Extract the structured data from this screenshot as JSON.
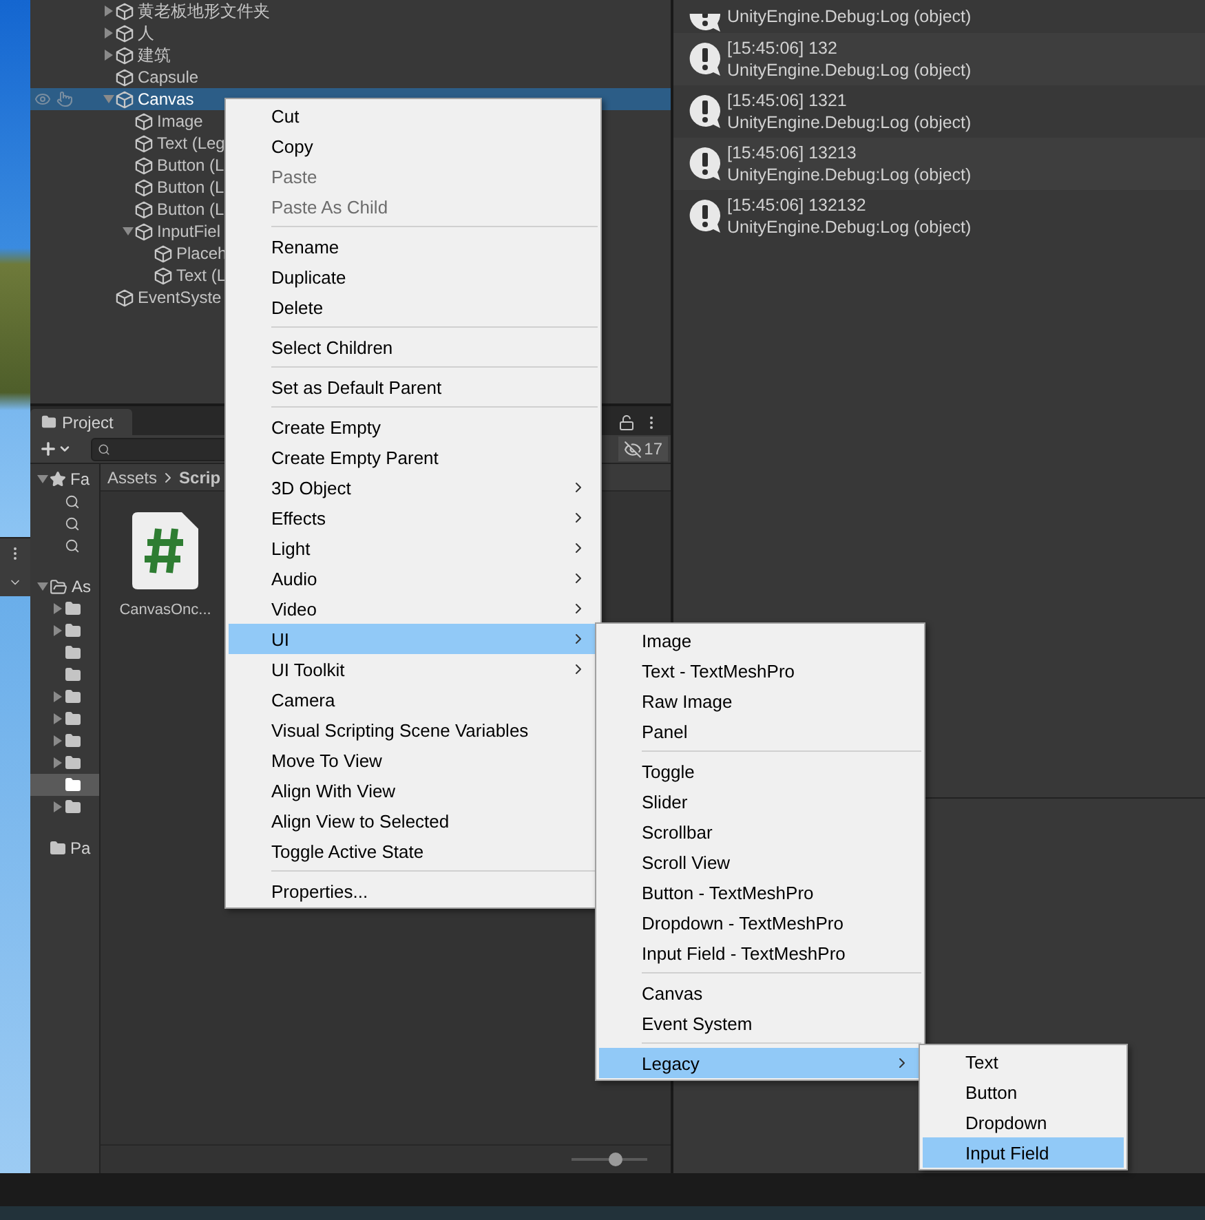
{
  "hierarchy": {
    "items": [
      {
        "label": "黄老板地形文件夹",
        "expanded": false,
        "selected": false,
        "hovered": false
      },
      {
        "label": "人",
        "expanded": false,
        "selected": false,
        "hovered": false
      },
      {
        "label": "建筑",
        "expanded": false,
        "selected": false,
        "hovered": false
      },
      {
        "label": "Capsule",
        "selected": false,
        "hovered": false
      },
      {
        "label": "Canvas",
        "expanded": true,
        "selected": true,
        "hovered": true,
        "children": [
          {
            "label": "Image",
            "selected": false,
            "hovered": false
          },
          {
            "label": "Text (Leg",
            "selected": false,
            "hovered": false
          },
          {
            "label": "Button (L",
            "selected": false,
            "hovered": false
          },
          {
            "label": "Button (L",
            "selected": false,
            "hovered": false
          },
          {
            "label": "Button (L",
            "selected": false,
            "hovered": false
          },
          {
            "label": "InputFiel",
            "expanded": true,
            "selected": false,
            "hovered": false,
            "children": [
              {
                "label": "Placeh",
                "selected": false,
                "hovered": false
              },
              {
                "label": "Text (L",
                "selected": false,
                "hovered": false
              }
            ]
          }
        ]
      },
      {
        "label": "EventSyste",
        "selected": false,
        "hovered": false
      }
    ]
  },
  "project": {
    "tab": "Project",
    "hidden_count": "17",
    "breadcrumb": [
      "Assets",
      "Scrip"
    ],
    "tree": [
      {
        "kind": "favorites",
        "label": "Fa",
        "expanded": true,
        "selected": false,
        "children": [
          {
            "kind": "search",
            "selected": false
          },
          {
            "kind": "search",
            "selected": false
          },
          {
            "kind": "search",
            "selected": false
          }
        ]
      },
      {
        "kind": "folder",
        "label": "As",
        "expanded": true,
        "selected": false,
        "children": [
          {
            "kind": "folder",
            "expanded": false,
            "selected": false
          },
          {
            "kind": "folder",
            "expanded": false,
            "selected": false
          },
          {
            "kind": "folder",
            "selected": false
          },
          {
            "kind": "folder",
            "selected": false
          },
          {
            "kind": "folder",
            "expanded": false,
            "selected": false
          },
          {
            "kind": "folder",
            "expanded": false,
            "selected": false
          },
          {
            "kind": "folder",
            "expanded": false,
            "selected": false
          },
          {
            "kind": "folder",
            "expanded": false,
            "selected": false
          },
          {
            "kind": "folder",
            "selected": true
          },
          {
            "kind": "folder",
            "expanded": false,
            "selected": false
          }
        ]
      },
      {
        "kind": "folder",
        "label": "Pa",
        "selected": false
      }
    ],
    "files": [
      {
        "kind": "script",
        "name": "CanvasOnc..."
      }
    ],
    "zoom": {
      "level": 0.58
    }
  },
  "console": {
    "entries": [
      {
        "message": "UnityEngine.Debug:Log (object)"
      },
      {
        "header": "[15:45:06] 132",
        "message": "UnityEngine.Debug:Log (object)"
      },
      {
        "header": "[15:45:06] 1321",
        "message": "UnityEngine.Debug:Log (object)"
      },
      {
        "header": "[15:45:06] 13213",
        "message": "UnityEngine.Debug:Log (object)"
      },
      {
        "header": "[15:45:06] 132132",
        "message": "UnityEngine.Debug:Log (object)"
      }
    ]
  },
  "context_menu": {
    "items": [
      {
        "kind": "item",
        "label": "Cut",
        "disabled": false,
        "selected": false,
        "submenu": false
      },
      {
        "kind": "item",
        "label": "Copy",
        "disabled": false,
        "selected": false,
        "submenu": false
      },
      {
        "kind": "item",
        "label": "Paste",
        "disabled": true,
        "selected": false,
        "submenu": false
      },
      {
        "kind": "item",
        "label": "Paste As Child",
        "disabled": true,
        "selected": false,
        "submenu": false
      },
      {
        "kind": "separator"
      },
      {
        "kind": "item",
        "label": "Rename",
        "disabled": false,
        "selected": false,
        "submenu": false
      },
      {
        "kind": "item",
        "label": "Duplicate",
        "disabled": false,
        "selected": false,
        "submenu": false
      },
      {
        "kind": "item",
        "label": "Delete",
        "disabled": false,
        "selected": false,
        "submenu": false
      },
      {
        "kind": "separator"
      },
      {
        "kind": "item",
        "label": "Select Children",
        "disabled": false,
        "selected": false,
        "submenu": false
      },
      {
        "kind": "separator"
      },
      {
        "kind": "item",
        "label": "Set as Default Parent",
        "disabled": false,
        "selected": false,
        "submenu": false
      },
      {
        "kind": "separator"
      },
      {
        "kind": "item",
        "label": "Create Empty",
        "disabled": false,
        "selected": false,
        "submenu": false
      },
      {
        "kind": "item",
        "label": "Create Empty Parent",
        "disabled": false,
        "selected": false,
        "submenu": false
      },
      {
        "kind": "item",
        "label": "3D Object",
        "disabled": false,
        "selected": false,
        "submenu": true
      },
      {
        "kind": "item",
        "label": "Effects",
        "disabled": false,
        "selected": false,
        "submenu": true
      },
      {
        "kind": "item",
        "label": "Light",
        "disabled": false,
        "selected": false,
        "submenu": true
      },
      {
        "kind": "item",
        "label": "Audio",
        "disabled": false,
        "selected": false,
        "submenu": true
      },
      {
        "kind": "item",
        "label": "Video",
        "disabled": false,
        "selected": false,
        "submenu": true
      },
      {
        "kind": "item",
        "label": "UI",
        "disabled": false,
        "selected": true,
        "submenu": true
      },
      {
        "kind": "item",
        "label": "UI Toolkit",
        "disabled": false,
        "selected": false,
        "submenu": true
      },
      {
        "kind": "item",
        "label": "Camera",
        "disabled": false,
        "selected": false,
        "submenu": false
      },
      {
        "kind": "item",
        "label": "Visual Scripting Scene Variables",
        "disabled": false,
        "selected": false,
        "submenu": false
      },
      {
        "kind": "item",
        "label": "Move To View",
        "disabled": false,
        "selected": false,
        "submenu": false
      },
      {
        "kind": "item",
        "label": "Align With View",
        "disabled": false,
        "selected": false,
        "submenu": false
      },
      {
        "kind": "item",
        "label": "Align View to Selected",
        "disabled": false,
        "selected": false,
        "submenu": false
      },
      {
        "kind": "item",
        "label": "Toggle Active State",
        "disabled": false,
        "selected": false,
        "submenu": false
      },
      {
        "kind": "separator"
      },
      {
        "kind": "item",
        "label": "Properties...",
        "disabled": false,
        "selected": false,
        "submenu": false
      }
    ]
  },
  "ui_submenu": {
    "items": [
      {
        "kind": "item",
        "label": "Image",
        "disabled": false,
        "selected": false,
        "submenu": false
      },
      {
        "kind": "item",
        "label": "Text - TextMeshPro",
        "disabled": false,
        "selected": false,
        "submenu": false
      },
      {
        "kind": "item",
        "label": "Raw Image",
        "disabled": false,
        "selected": false,
        "submenu": false
      },
      {
        "kind": "item",
        "label": "Panel",
        "disabled": false,
        "selected": false,
        "submenu": false
      },
      {
        "kind": "separator"
      },
      {
        "kind": "item",
        "label": "Toggle",
        "disabled": false,
        "selected": false,
        "submenu": false
      },
      {
        "kind": "item",
        "label": "Slider",
        "disabled": false,
        "selected": false,
        "submenu": false
      },
      {
        "kind": "item",
        "label": "Scrollbar",
        "disabled": false,
        "selected": false,
        "submenu": false
      },
      {
        "kind": "item",
        "label": "Scroll View",
        "disabled": false,
        "selected": false,
        "submenu": false
      },
      {
        "kind": "item",
        "label": "Button - TextMeshPro",
        "disabled": false,
        "selected": false,
        "submenu": false
      },
      {
        "kind": "item",
        "label": "Dropdown - TextMeshPro",
        "disabled": false,
        "selected": false,
        "submenu": false
      },
      {
        "kind": "item",
        "label": "Input Field - TextMeshPro",
        "disabled": false,
        "selected": false,
        "submenu": false
      },
      {
        "kind": "separator"
      },
      {
        "kind": "item",
        "label": "Canvas",
        "disabled": false,
        "selected": false,
        "submenu": false
      },
      {
        "kind": "item",
        "label": "Event System",
        "disabled": false,
        "selected": false,
        "submenu": false
      },
      {
        "kind": "separator"
      },
      {
        "kind": "item",
        "label": "Legacy",
        "disabled": false,
        "selected": true,
        "submenu": true
      }
    ]
  },
  "legacy_submenu": {
    "items": [
      {
        "kind": "item",
        "label": "Text",
        "disabled": false,
        "selected": false,
        "submenu": false
      },
      {
        "kind": "item",
        "label": "Button",
        "disabled": false,
        "selected": false,
        "submenu": false
      },
      {
        "kind": "item",
        "label": "Dropdown",
        "disabled": false,
        "selected": false,
        "submenu": false
      },
      {
        "kind": "item",
        "label": "Input Field",
        "disabled": false,
        "selected": true,
        "submenu": false
      }
    ]
  }
}
